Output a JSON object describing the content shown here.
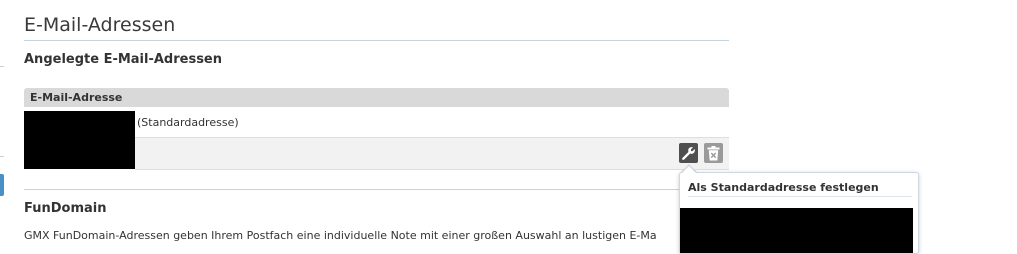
{
  "page": {
    "title": "E-Mail-Adressen"
  },
  "created_addresses": {
    "heading": "Angelegte E-Mail-Adressen",
    "column_header": "E-Mail-Adresse",
    "rows": [
      {
        "address": "",
        "label": "(Standardadresse)"
      }
    ]
  },
  "actions": {
    "edit_icon": "wrench-icon",
    "delete_icon": "trash-icon"
  },
  "tooltip": {
    "title": "Als Standardadresse festlegen"
  },
  "fundomain": {
    "heading": "FunDomain",
    "text": "GMX FunDomain-Adressen geben Ihrem Postfach eine individuelle Note mit einer großen Auswahl an lustigen E-Ma"
  },
  "colors": {
    "header_bg": "#d9d9d9",
    "rule": "#c5d3df",
    "accent": "#4a90c8"
  }
}
